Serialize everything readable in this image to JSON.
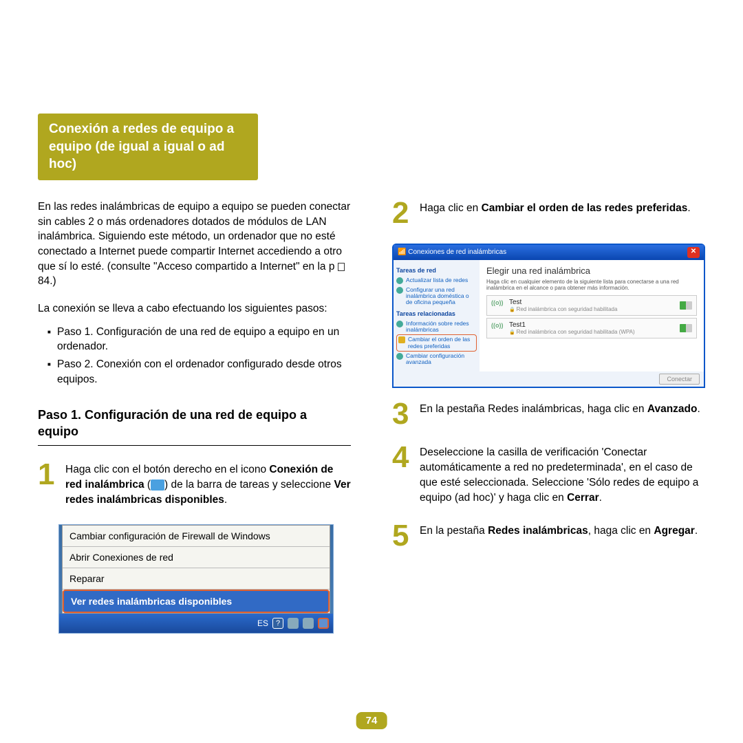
{
  "header": "Conexión a redes de equipo a equipo (de igual a igual o ad hoc)",
  "intro1_prefix": "En las redes inalámbricas de equipo a equipo se pueden conectar sin cables 2 o más ordenadores dotados de módulos de LAN inalámbrica. Siguiendo este método, un ordenador que no esté conectado a Internet puede compartir Internet accediendo a otro que sí lo esté. (consulte \"Acceso compartido a Internet\" en la p ",
  "intro1_suffix": " 84.)",
  "intro2": "La conexión se lleva a cabo efectuando los siguientes pasos:",
  "bullets": [
    "Paso 1. Configuración de una red de equipo a equipo en un ordenador.",
    "Paso 2. Conexión con el ordenador configurado desde otros equipos."
  ],
  "step_heading": "Paso 1. Configuración de una red de equipo a equipo",
  "step1": {
    "num": "1",
    "t1": "Haga clic con el botón derecho en el icono ",
    "b1": "Conexión de red inalámbrica",
    "t2": " (",
    "t3": ") de la barra de tareas y seleccione ",
    "b2": "Ver redes inalámbricas disponibles",
    "t4": "."
  },
  "ctx": {
    "i1": "Cambiar configuración de Firewall de Windows",
    "i2": "Abrir Conexiones de red",
    "i3": "Reparar",
    "i4": "Ver redes inalámbricas disponibles",
    "lang": "ES"
  },
  "step2": {
    "num": "2",
    "t1": "Haga clic en ",
    "b1": "Cambiar el orden de las redes preferidas",
    "t2": "."
  },
  "dlg": {
    "title": "Conexiones de red inalámbricas",
    "side_h1": "Tareas de red",
    "side_i1": "Actualizar lista de redes",
    "side_i2": "Configurar una red inalámbrica doméstica o de oficina pequeña",
    "side_h2": "Tareas relacionadas",
    "side_i3": "Información sobre redes inalámbricas",
    "side_i4": "Cambiar el orden de las redes preferidas",
    "side_i5": "Cambiar configuración avanzada",
    "main_h": "Elegir una red inalámbrica",
    "main_sub": "Haga clic en cualquier elemento de la siguiente lista para conectarse a una red inalámbrica en el alcance o para obtener más información.",
    "net1_name": "Test",
    "net1_sec": "Red inalámbrica con seguridad habilitada",
    "net2_name": "Test1",
    "net2_sec": "Red inalámbrica con seguridad habilitada (WPA)",
    "btn": "Conectar"
  },
  "step3": {
    "num": "3",
    "t1": "En la pestaña Redes inalámbricas, haga clic en ",
    "b1": "Avanzado",
    "t2": "."
  },
  "step4": {
    "num": "4",
    "t1": "Deseleccione la casilla de verificación 'Conectar automáticamente a red no predeterminada', en el caso de que esté seleccionada. Seleccione 'Sólo redes de equipo a equipo (ad hoc)' y haga clic en ",
    "b1": "Cerrar",
    "t2": "."
  },
  "step5": {
    "num": "5",
    "t1": "En la pestaña ",
    "b1": "Redes inalámbricas",
    "t2": ", haga clic en ",
    "b2": "Agregar",
    "t3": "."
  },
  "pagenum": "74"
}
